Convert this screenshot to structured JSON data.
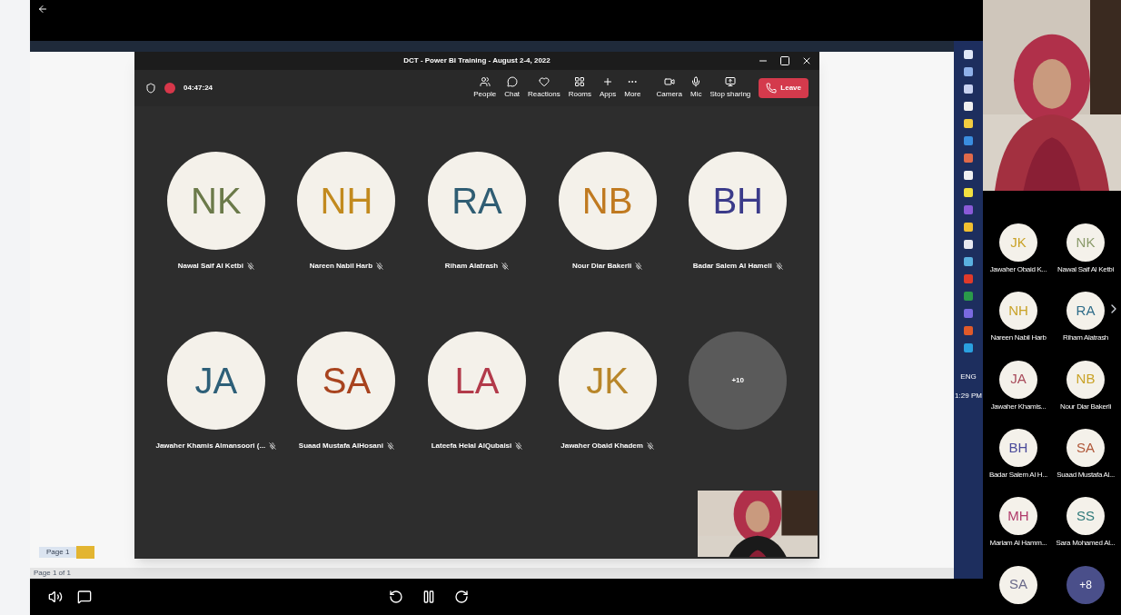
{
  "meeting_window": {
    "title": "DCT - Power BI Training - August 2-4, 2022",
    "timer": "04:47:24",
    "toolbar": [
      {
        "label": "People"
      },
      {
        "label": "Chat"
      },
      {
        "label": "Reactions"
      },
      {
        "label": "Rooms"
      },
      {
        "label": "Apps"
      },
      {
        "label": "More"
      },
      {
        "label": "Camera"
      },
      {
        "label": "Mic"
      },
      {
        "label": "Stop sharing"
      }
    ],
    "leave_button": "Leave",
    "participants": [
      {
        "initials": "NK",
        "name": "Nawal Saif Al Ketbi",
        "color": "#6b7a4a",
        "muted": true
      },
      {
        "initials": "NH",
        "name": "Nareen Nabil Harb",
        "color": "#c28a1e",
        "muted": true
      },
      {
        "initials": "RA",
        "name": "Riham Alatrash",
        "color": "#2f5d73",
        "muted": true
      },
      {
        "initials": "NB",
        "name": "Nour Diar Bakerli",
        "color": "#c07a20",
        "muted": true
      },
      {
        "initials": "BH",
        "name": "Badar Salem Al Hameli",
        "color": "#3b3b8a",
        "muted": true
      },
      {
        "initials": "JA",
        "name": "Jawaher Khamis Almansoori (...",
        "color": "#2d5f78",
        "muted": true
      },
      {
        "initials": "SA",
        "name": "Suaad Mustafa AlHosani",
        "color": "#a8431e",
        "muted": true
      },
      {
        "initials": "LA",
        "name": "Lateefa Helal AlQubaisi",
        "color": "#b23a4a",
        "muted": true
      },
      {
        "initials": "JK",
        "name": "Jawaher Obaid Khadem",
        "color": "#b8862a",
        "muted": true
      }
    ],
    "overflow": "+10"
  },
  "desktop": {
    "page_tab": "Page 1",
    "page_status": "Page 1 of 1"
  },
  "taskbar": {
    "language": "ENG",
    "time": "1:29 PM"
  },
  "side_gallery": [
    {
      "initials": "JK",
      "name": "Jawaher Obaid K...",
      "color": "#c9a227"
    },
    {
      "initials": "NK",
      "name": "Nawal Saif Al Ketbi",
      "color": "#8a9a6a"
    },
    {
      "initials": "NH",
      "name": "Nareen Nabil Harb",
      "color": "#c9a227"
    },
    {
      "initials": "RA",
      "name": "Riham Alatrash",
      "color": "#2f6d8a"
    },
    {
      "initials": "JA",
      "name": "Jawaher Khamis...",
      "color": "#a84a5a"
    },
    {
      "initials": "NB",
      "name": "Nour Diar Bakerli",
      "color": "#c9a227"
    },
    {
      "initials": "BH",
      "name": "Badar Salem Al H...",
      "color": "#4a4a9a"
    },
    {
      "initials": "SA",
      "name": "Suaad Mustafa Al...",
      "color": "#b0583a"
    },
    {
      "initials": "MH",
      "name": "Mariam Al Hamm...",
      "color": "#b03a6a"
    },
    {
      "initials": "SS",
      "name": "Sara Mohamed Al...",
      "color": "#2f7a7a"
    },
    {
      "initials": "SA",
      "color": "#6a6a8a"
    }
  ],
  "side_overflow": "+8"
}
